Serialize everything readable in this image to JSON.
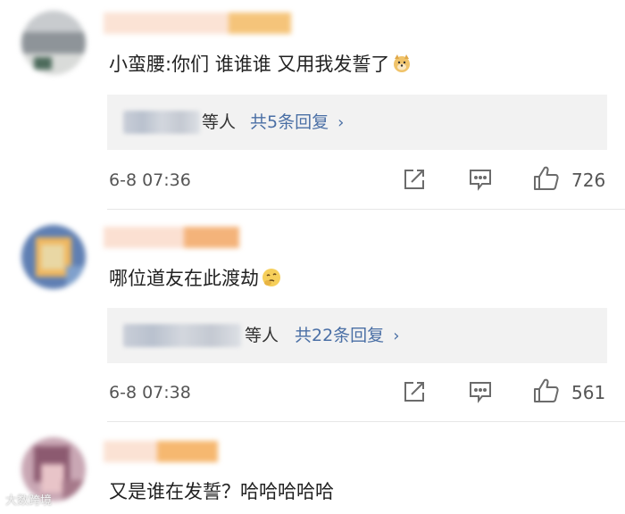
{
  "comments": [
    {
      "text": "小蛮腰:你们 谁谁谁 又用我发誓了",
      "emoji": "doge-emoji-icon",
      "reply_users_suffix": "等人",
      "reply_link": "共5条回复",
      "time": "6-8 07:36",
      "likes": "726"
    },
    {
      "text": "哪位道友在此渡劫",
      "emoji": "thinking-emoji-icon",
      "reply_users_suffix": "等人",
      "reply_link": "共22条回复",
      "time": "6-8 07:38",
      "likes": "561"
    },
    {
      "text": "又是谁在发誓？哈哈哈哈哈"
    }
  ],
  "watermark": "大数跨境",
  "colors": {
    "link": "#4a6fa5",
    "reply_bg": "#f2f2f2",
    "text": "#222222",
    "meta": "#555555"
  }
}
